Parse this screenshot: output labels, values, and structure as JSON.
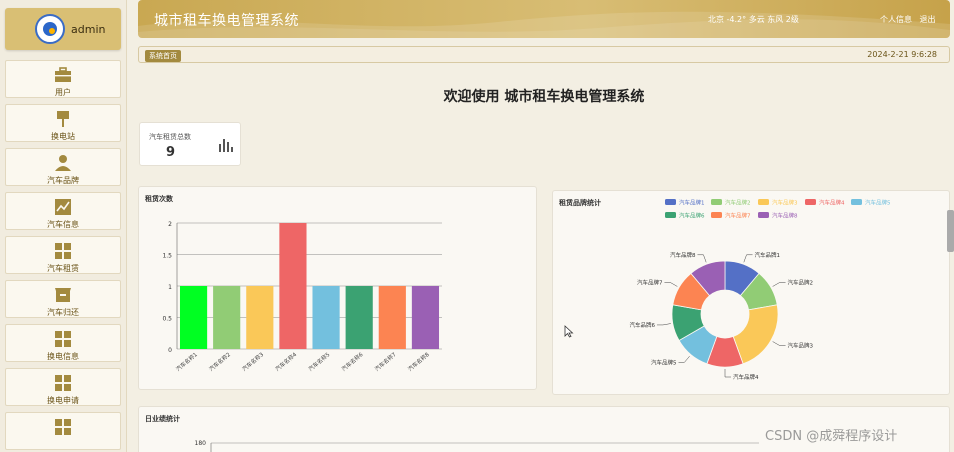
{
  "sidebar": {
    "username": "admin",
    "items": [
      {
        "label": "用户",
        "icon": "briefcase-icon"
      },
      {
        "label": "换电站",
        "icon": "station-icon"
      },
      {
        "label": "汽车品牌",
        "icon": "person-icon"
      },
      {
        "label": "汽车信息",
        "icon": "chart-line-icon"
      },
      {
        "label": "汽车租赁",
        "icon": "grid-icon"
      },
      {
        "label": "汽车归还",
        "icon": "box-icon"
      },
      {
        "label": "换电信息",
        "icon": "grid-icon"
      },
      {
        "label": "换电申请",
        "icon": "grid-icon"
      },
      {
        "label": "",
        "icon": "grid-icon"
      }
    ]
  },
  "header": {
    "title": "城市租车换电管理系统",
    "weather": "北京  -4.2°  多云  东风  2级",
    "links": [
      "个人信息",
      "退出"
    ]
  },
  "breadcrumb": {
    "label": "系统首页",
    "datetime": "2024-2-21 9:6:28"
  },
  "welcome": "欢迎使用 城市租车换电管理系统",
  "stat": {
    "title": "汽车租赁总数",
    "value": "9"
  },
  "panels": {
    "rent": "租赁次数",
    "brand": "租赁品牌统计",
    "daily": "日业绩统计"
  },
  "watermark": "CSDN @成舜程序设计",
  "colors": {
    "header": "#c9a852",
    "accent": "#a38a3f"
  },
  "chart_data": [
    {
      "type": "bar",
      "title": "租赁次数",
      "categories": [
        "汽车名称1",
        "汽车名称2",
        "汽车名称3",
        "汽车名称4",
        "汽车名称5",
        "汽车名称6",
        "汽车名称7",
        "汽车名称8"
      ],
      "values": [
        1,
        1,
        1,
        2,
        1,
        1,
        1,
        1
      ],
      "colors": [
        "#00ff22",
        "#91cc75",
        "#fac858",
        "#ee6666",
        "#73c0de",
        "#3ba272",
        "#fc8452",
        "#9a60b4"
      ],
      "yticks": [
        "0",
        "0.5",
        "1",
        "1.5",
        "2"
      ],
      "ylim": [
        0,
        2
      ]
    },
    {
      "type": "pie",
      "title": "租赁品牌统计",
      "labels": [
        "汽车品牌1",
        "汽车品牌2",
        "汽车品牌3",
        "汽车品牌4",
        "汽车品牌5",
        "汽车品牌6",
        "汽车品牌7",
        "汽车品牌8"
      ],
      "values": [
        1,
        1,
        2,
        1,
        1,
        1,
        1,
        1
      ],
      "colors": [
        "#5470c6",
        "#91cc75",
        "#fac858",
        "#ee6666",
        "#73c0de",
        "#3ba272",
        "#fc8452",
        "#9a60b4"
      ],
      "legend": "top"
    },
    {
      "type": "line",
      "title": "日业绩统计",
      "yticks": [
        "180"
      ]
    }
  ]
}
